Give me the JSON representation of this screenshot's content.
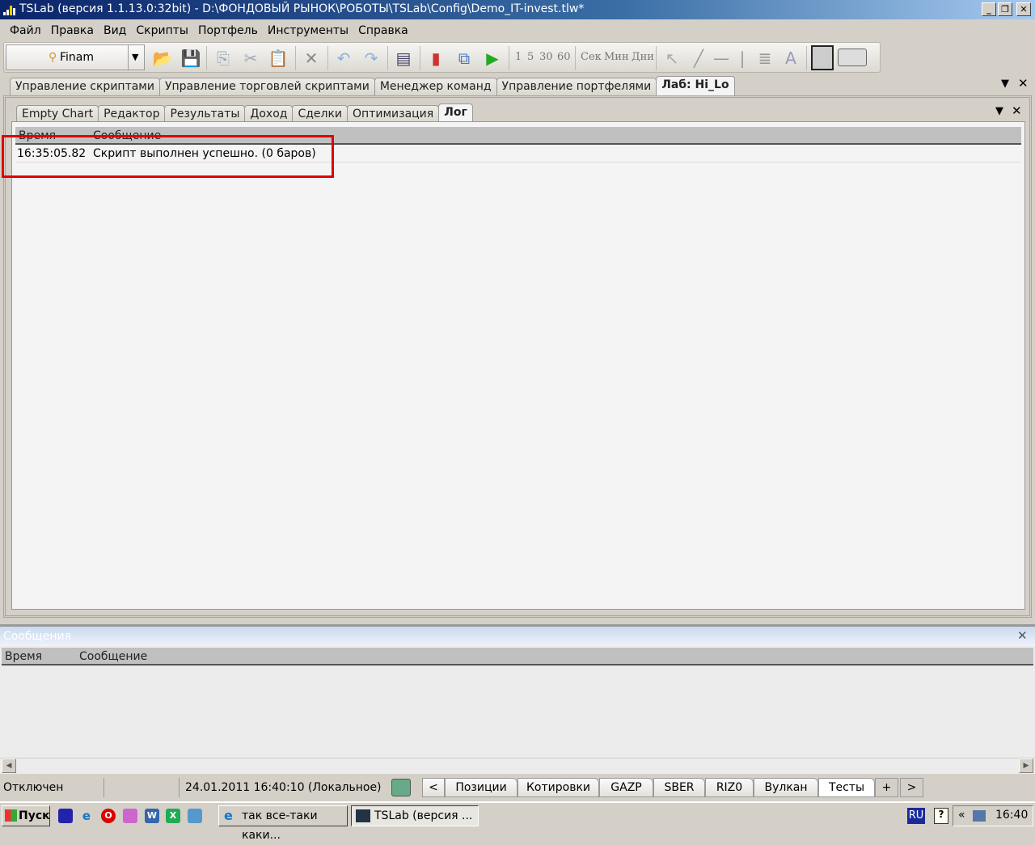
{
  "window": {
    "title": "TSLab (версия 1.1.13.0:32bit) - D:\\ФОНДОВЫЙ РЫНОК\\РОБОТЫ\\TSLab\\Config\\Demo_IT-invest.tlw*",
    "minimize": "_",
    "restore": "❐",
    "close": "✕"
  },
  "menu": [
    "Файл",
    "Правка",
    "Вид",
    "Скрипты",
    "Портфель",
    "Инструменты",
    "Справка"
  ],
  "toolbar": {
    "broker": "Finam",
    "intervals": [
      "1",
      "5",
      "30",
      "60"
    ],
    "units": [
      "Сек",
      "Мин",
      "Дни"
    ]
  },
  "doc_tabs": [
    {
      "label": "Управление скриптами"
    },
    {
      "label": "Управление торговлей скриптами"
    },
    {
      "label": "Менеджер команд"
    },
    {
      "label": "Управление портфелями"
    },
    {
      "label": "Лаб: Hi_Lo",
      "active": true
    }
  ],
  "sub_tabs": [
    {
      "label": "Empty Chart"
    },
    {
      "label": "Редактор"
    },
    {
      "label": "Результаты"
    },
    {
      "label": "Доход"
    },
    {
      "label": "Сделки"
    },
    {
      "label": "Оптимизация"
    },
    {
      "label": "Лог",
      "active": true
    }
  ],
  "log": {
    "columns": [
      "Время",
      "Сообщение"
    ],
    "rows": [
      {
        "time": "16:35:05.82",
        "message": "Скрипт выполнен успешно. (0 баров)"
      }
    ]
  },
  "messages": {
    "title": "Сообщения",
    "columns": [
      "Время",
      "Сообщение"
    ]
  },
  "statusbar": {
    "connection": "Отключен",
    "datetime": "24.01.2011 16:40:10 (Локальное)",
    "prev": "<",
    "next": ">",
    "add": "+",
    "tabs": [
      {
        "label": "Позиции"
      },
      {
        "label": "Котировки"
      },
      {
        "label": "GAZP"
      },
      {
        "label": "SBER"
      },
      {
        "label": "RIZ0"
      },
      {
        "label": "Вулкан"
      },
      {
        "label": "Тесты",
        "active": true
      }
    ]
  },
  "taskbar": {
    "start": "Пуск",
    "tasks": [
      {
        "label": "так все-таки каки..."
      },
      {
        "label": "TSLab (версия ...",
        "active": true
      }
    ],
    "lang": "RU",
    "clock": "16:40",
    "tray_expand": "«"
  },
  "colors": {
    "highlight": "#e00000",
    "titlebar": "#0a246a"
  }
}
